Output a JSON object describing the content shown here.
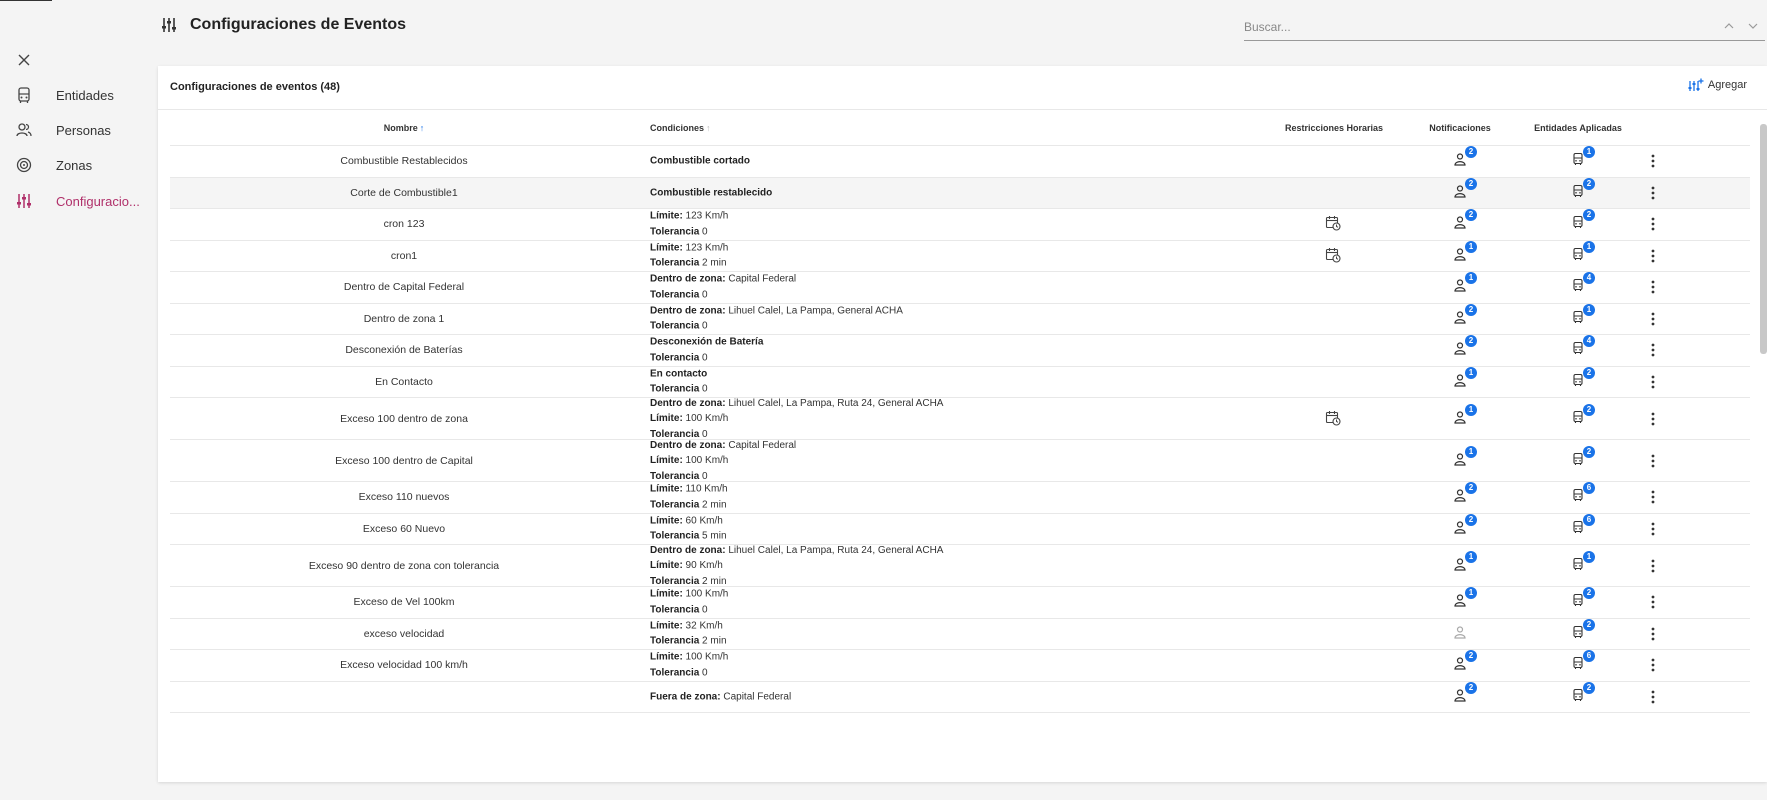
{
  "sidebar": {
    "items": [
      {
        "label": "Entidades",
        "icon": "vehicle-icon",
        "active": false
      },
      {
        "label": "Personas",
        "icon": "persons-icon",
        "active": false
      },
      {
        "label": "Zonas",
        "icon": "zone-icon",
        "active": false
      },
      {
        "label": "Configuracio...",
        "icon": "sliders-icon",
        "active": true
      }
    ]
  },
  "header": {
    "title": "Configuraciones de Eventos",
    "search_placeholder": "Buscar..."
  },
  "card": {
    "title": "Configuraciones de eventos (48)",
    "add_label": "Agregar"
  },
  "table": {
    "columns": {
      "name": "Nombre",
      "conditions": "Condiciones",
      "restrictions": "Restricciones Horarias",
      "notifications": "Notificaciones",
      "entities": "Entidades Aplicadas"
    },
    "rows": [
      {
        "name": "Combustible Restablecidos",
        "cond": [
          {
            "k": "Combustible cortado",
            "v": ""
          }
        ],
        "cal": false,
        "notif": "2",
        "ent": "1"
      },
      {
        "name": "Corte de Combustible1",
        "cond": [
          {
            "k": "Combustible restablecido",
            "v": ""
          }
        ],
        "cal": false,
        "notif": "2",
        "ent": "2"
      },
      {
        "name": "cron 123",
        "cond": [
          {
            "k": "Límite:",
            "v": "123 Km/h"
          },
          {
            "k": "Tolerancia",
            "v": "0"
          }
        ],
        "cal": true,
        "notif": "2",
        "ent": "2"
      },
      {
        "name": "cron1",
        "cond": [
          {
            "k": "Límite:",
            "v": "123 Km/h"
          },
          {
            "k": "Tolerancia",
            "v": "2 min"
          }
        ],
        "cal": true,
        "notif": "1",
        "ent": "1"
      },
      {
        "name": "Dentro de Capital Federal",
        "cond": [
          {
            "k": "Dentro de zona:",
            "v": "Capital Federal"
          },
          {
            "k": "Tolerancia",
            "v": "0"
          }
        ],
        "cal": false,
        "notif": "1",
        "ent": "4"
      },
      {
        "name": "Dentro de zona 1",
        "cond": [
          {
            "k": "Dentro de zona:",
            "v": "Lihuel Calel, La Pampa, General ACHA"
          },
          {
            "k": "Tolerancia",
            "v": "0"
          }
        ],
        "cal": false,
        "notif": "2",
        "ent": "1"
      },
      {
        "name": "Desconexión de Baterías",
        "cond": [
          {
            "k": "Desconexión de Batería",
            "v": ""
          },
          {
            "k": "Tolerancia",
            "v": "0"
          }
        ],
        "cal": false,
        "notif": "2",
        "ent": "4"
      },
      {
        "name": "En Contacto",
        "cond": [
          {
            "k": "En contacto",
            "v": ""
          },
          {
            "k": "Tolerancia",
            "v": "0"
          }
        ],
        "cal": false,
        "notif": "1",
        "ent": "2"
      },
      {
        "name": "Exceso 100 dentro de zona",
        "cond": [
          {
            "k": "Dentro de zona:",
            "v": "Lihuel Calel, La Pampa, Ruta 24, General ACHA"
          },
          {
            "k": "Límite:",
            "v": "100 Km/h"
          },
          {
            "k": "Tolerancia",
            "v": "0"
          }
        ],
        "cal": true,
        "notif": "1",
        "ent": "2"
      },
      {
        "name": "Exceso 100 dentro de Capital",
        "cond": [
          {
            "k": "Dentro de zona:",
            "v": "Capital Federal"
          },
          {
            "k": "Límite:",
            "v": "100 Km/h"
          },
          {
            "k": "Tolerancia",
            "v": "0"
          }
        ],
        "cal": false,
        "notif": "1",
        "ent": "2"
      },
      {
        "name": "Exceso 110 nuevos",
        "cond": [
          {
            "k": "Límite:",
            "v": "110 Km/h"
          },
          {
            "k": "Tolerancia",
            "v": "2 min"
          }
        ],
        "cal": false,
        "notif": "2",
        "ent": "6"
      },
      {
        "name": "Exceso 60 Nuevo",
        "cond": [
          {
            "k": "Límite:",
            "v": "60 Km/h"
          },
          {
            "k": "Tolerancia",
            "v": "5 min"
          }
        ],
        "cal": false,
        "notif": "2",
        "ent": "6"
      },
      {
        "name": "Exceso 90 dentro de zona con tolerancia",
        "cond": [
          {
            "k": "Dentro de zona:",
            "v": "Lihuel Calel, La Pampa, Ruta 24, General ACHA"
          },
          {
            "k": "Límite:",
            "v": "90 Km/h"
          },
          {
            "k": "Tolerancia",
            "v": "2 min"
          }
        ],
        "cal": false,
        "notif": "1",
        "ent": "1"
      },
      {
        "name": "Exceso de Vel 100km",
        "cond": [
          {
            "k": "Límite:",
            "v": "100 Km/h"
          },
          {
            "k": "Tolerancia",
            "v": "0"
          }
        ],
        "cal": false,
        "notif": "1",
        "ent": "2"
      },
      {
        "name": "exceso velocidad",
        "cond": [
          {
            "k": "Límite:",
            "v": "32 Km/h"
          },
          {
            "k": "Tolerancia",
            "v": "2 min"
          }
        ],
        "cal": false,
        "notif": "",
        "ent": "2"
      },
      {
        "name": "Exceso velocidad 100 km/h",
        "cond": [
          {
            "k": "Límite:",
            "v": "100 Km/h"
          },
          {
            "k": "Tolerancia",
            "v": "0"
          }
        ],
        "cal": false,
        "notif": "2",
        "ent": "6"
      },
      {
        "name": "",
        "cond": [
          {
            "k": "Fuera de zona:",
            "v": "Capital Federal"
          }
        ],
        "cal": false,
        "notif": "2",
        "ent": "2"
      }
    ]
  },
  "colors": {
    "accent": "#b0306a",
    "badge": "#1a73e8"
  }
}
